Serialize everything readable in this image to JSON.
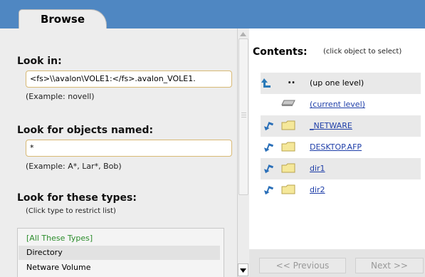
{
  "tab": {
    "label": "Browse"
  },
  "look_in": {
    "label": "Look in:",
    "value": "<fs>\\\\avalon\\VOLE1:</fs>.avalon_VOLE1.",
    "example": "(Example: novell)"
  },
  "look_for": {
    "label": "Look for objects named:",
    "value": "*",
    "example": "(Example: A*, Lar*, Bob)"
  },
  "types": {
    "label": "Look for these types:",
    "hint": "(Click type to restrict list)",
    "items": [
      "[All These Types]",
      "Directory",
      "Netware Volume"
    ]
  },
  "contents": {
    "title": "Contents:",
    "hint": "(click object to select)",
    "items": [
      {
        "dots": "..",
        "name": "(up one level)",
        "icon": "up-arrow-icon"
      },
      {
        "name": "(current level)",
        "icon": "volume-icon"
      },
      {
        "name": "_NETWARE",
        "icon": "folder-icon"
      },
      {
        "name": "DESKTOP.AFP",
        "icon": "folder-icon"
      },
      {
        "name": "dir1",
        "icon": "folder-icon"
      },
      {
        "name": "dir2",
        "icon": "folder-icon"
      }
    ],
    "prev_label": "<< Previous",
    "next_label": "Next >>"
  },
  "colors": {
    "header_blue": "#4f87c2",
    "link_blue": "#1e3ea8",
    "field_border": "#d8b974",
    "types_green": "#2c8d2c"
  }
}
